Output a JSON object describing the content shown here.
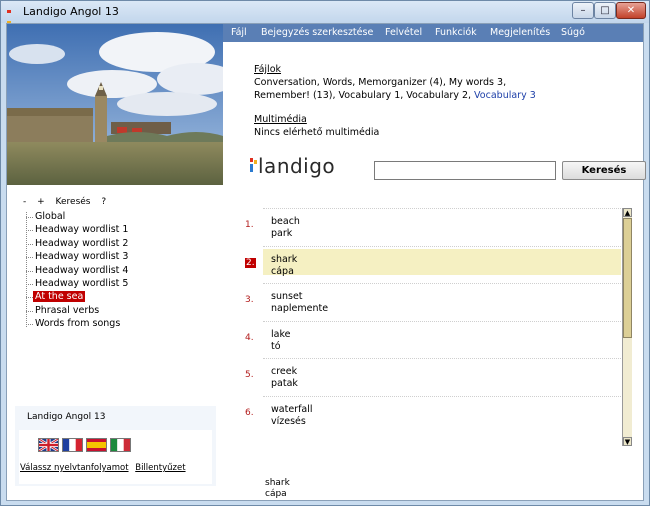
{
  "window": {
    "title": "Landigo Angol 13"
  },
  "menu": [
    "Fájl",
    "Bejegyzés szerkesztése",
    "Felvétel",
    "Funkciók",
    "Megjelenítés",
    "Súgó"
  ],
  "files": {
    "label": "Fájlok",
    "line1": "Conversation, Words, Memorganizer (4), My words 3,",
    "line2_plain": "Remember! (13), Vocabulary 1, Vocabulary 2, ",
    "line2_link": "Vocabulary 3"
  },
  "multimedia": {
    "label": "Multimédia",
    "value": "Nincs elérhető multimédia"
  },
  "logo_text": "landigo",
  "search": {
    "value": "",
    "button_label": "Keresés"
  },
  "tree": {
    "header": {
      "minus": "-",
      "plus": "+",
      "search": "Keresés",
      "help": "?"
    },
    "items": [
      "Global",
      "Headway wordlist 1",
      "Headway wordlist 2",
      "Headway wordlist 3",
      "Headway wordlist 4",
      "Headway wordlist 5",
      "At the sea",
      "Phrasal verbs",
      "Words from songs"
    ],
    "selected": "At the sea"
  },
  "course_box": {
    "title": "Landigo Angol 13",
    "flags": [
      "uk-flag-icon",
      "france-flag-icon",
      "spain-flag-icon",
      "italy-flag-icon"
    ],
    "link_choose": "Válassz nyelvtanfolyamot",
    "link_keyboard": "Billentyűzet"
  },
  "words": [
    {
      "num": "1.",
      "en": "beach",
      "hu": "park",
      "selected": false
    },
    {
      "num": "2.",
      "en": "shark",
      "hu": "cápa",
      "selected": true
    },
    {
      "num": "3.",
      "en": "sunset",
      "hu": "naplemente",
      "selected": false
    },
    {
      "num": "4.",
      "en": "lake",
      "hu": "tó",
      "selected": false
    },
    {
      "num": "5.",
      "en": "creek",
      "hu": "patak",
      "selected": false
    },
    {
      "num": "6.",
      "en": "waterfall",
      "hu": "vízesés",
      "selected": false
    }
  ],
  "detail": {
    "en": "shark",
    "hu": "cápa"
  },
  "colors": {
    "accent_red": "#c00000",
    "menubar": "#5a7fb5",
    "highlight": "#f5f0c2"
  }
}
